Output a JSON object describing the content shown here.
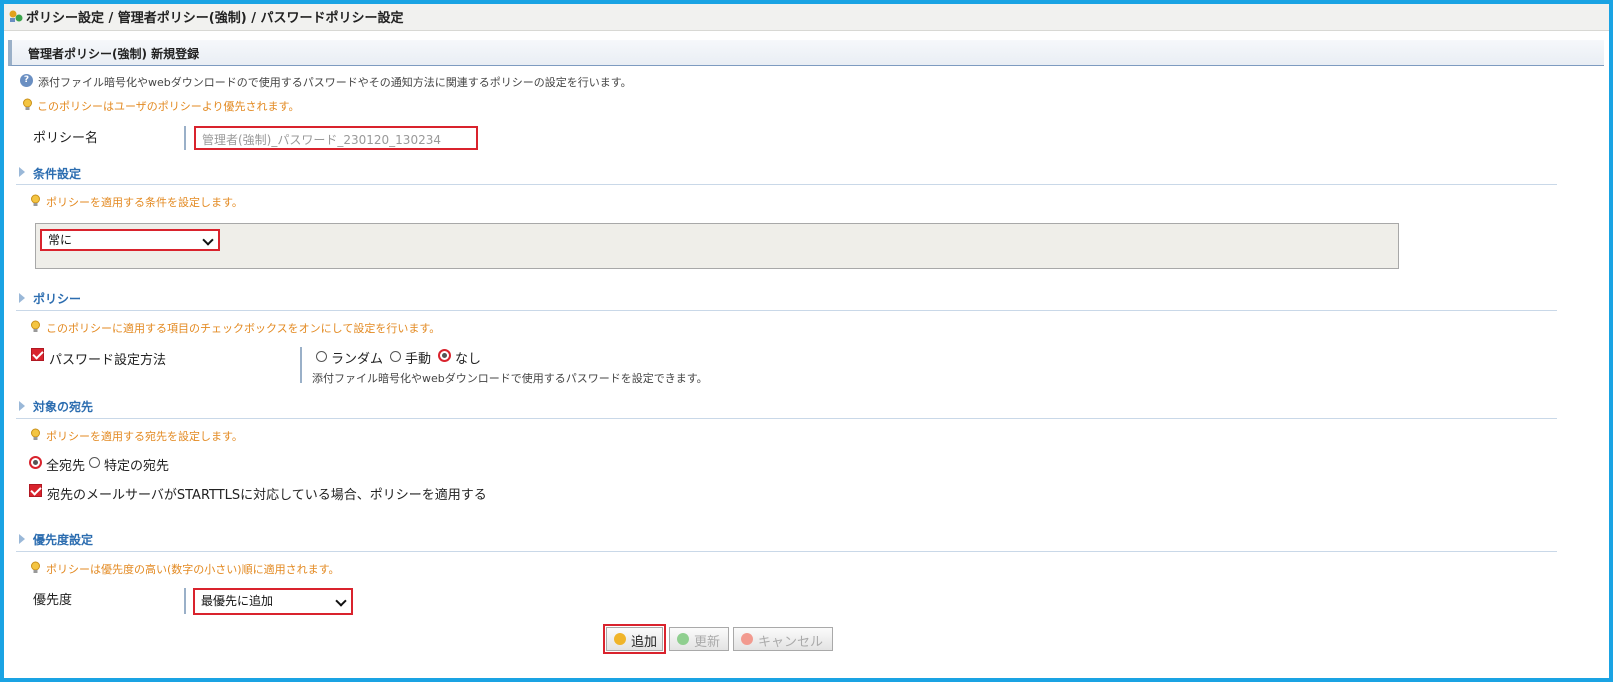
{
  "breadcrumb": {
    "title": "ポリシー設定 / 管理者ポリシー(強制) / パスワードポリシー設定"
  },
  "form": {
    "header": "管理者ポリシー(強制) 新規登録",
    "info": "添付ファイル暗号化やwebダウンロードので使用するパスワードやその通知方法に関連するポリシーの設定を行います。",
    "priority_note": "このポリシーはユーザのポリシーより優先されます。",
    "policy_name_label": "ポリシー名",
    "policy_name_placeholder": "管理者(強制)_パスワード_230120_130234"
  },
  "conditions": {
    "title": "条件設定",
    "hint": "ポリシーを適用する条件を設定します。",
    "select_value": "常に"
  },
  "policy": {
    "title": "ポリシー",
    "hint": "このポリシーに適用する項目のチェックボックスをオンにして設定を行います。",
    "password_method_label": "パスワード設定方法",
    "checked": true,
    "options": [
      "ランダム",
      "手動",
      "なし"
    ],
    "selected": "なし",
    "description": "添付ファイル暗号化やwebダウンロードで使用するパスワードを設定できます。"
  },
  "recipients": {
    "title": "対象の宛先",
    "hint": "ポリシーを適用する宛先を設定します。",
    "options": [
      "全宛先",
      "特定の宛先"
    ],
    "selected": "全宛先",
    "starttls_label": "宛先のメールサーバがSTARTTLSに対応している場合、ポリシーを適用する",
    "starttls_checked": true
  },
  "priority": {
    "title": "優先度設定",
    "hint": "ポリシーは優先度の高い(数字の小さい)順に適用されます。",
    "label": "優先度",
    "select_value": "最優先に追加"
  },
  "buttons": {
    "add": "追加",
    "update": "更新",
    "cancel": "キャンセル"
  },
  "colors": {
    "frame": "#1aa3e3",
    "highlight": "#d9232d",
    "section_title": "#2c6db0",
    "hint": "#e38a22"
  }
}
